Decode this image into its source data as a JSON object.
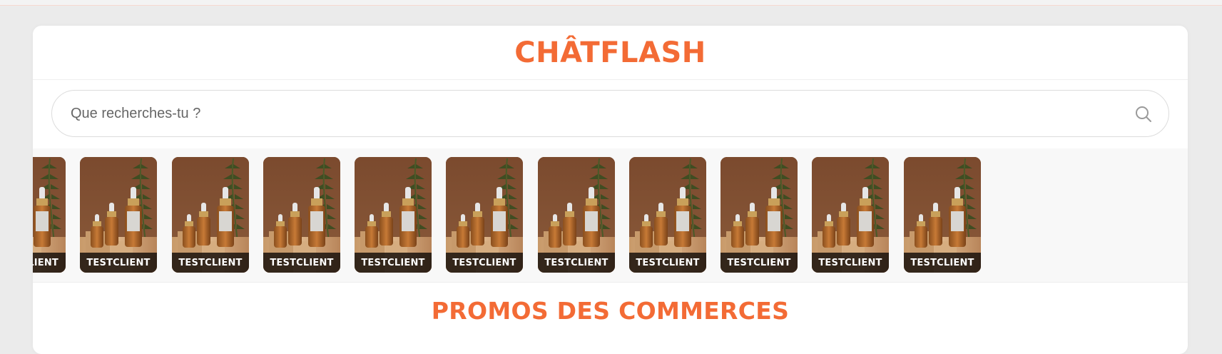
{
  "header": {
    "brand": "CHÂTFLASH"
  },
  "search": {
    "placeholder": "Que recherches-tu ?"
  },
  "stories": {
    "items": [
      {
        "label": "TESTCLIENT"
      },
      {
        "label": "TESTCLIENT"
      },
      {
        "label": "TESTCLIENT"
      },
      {
        "label": "TESTCLIENT"
      },
      {
        "label": "TESTCLIENT"
      },
      {
        "label": "TESTCLIENT"
      },
      {
        "label": "TESTCLIENT"
      },
      {
        "label": "TESTCLIENT"
      },
      {
        "label": "TESTCLIENT"
      },
      {
        "label": "TESTCLIENT"
      },
      {
        "label": "TESTCLIENT"
      }
    ]
  },
  "sections": {
    "promos_title": "PROMOS DES COMMERCES"
  },
  "colors": {
    "accent": "#f36b35",
    "background": "#ebebeb",
    "card": "#ffffff"
  }
}
